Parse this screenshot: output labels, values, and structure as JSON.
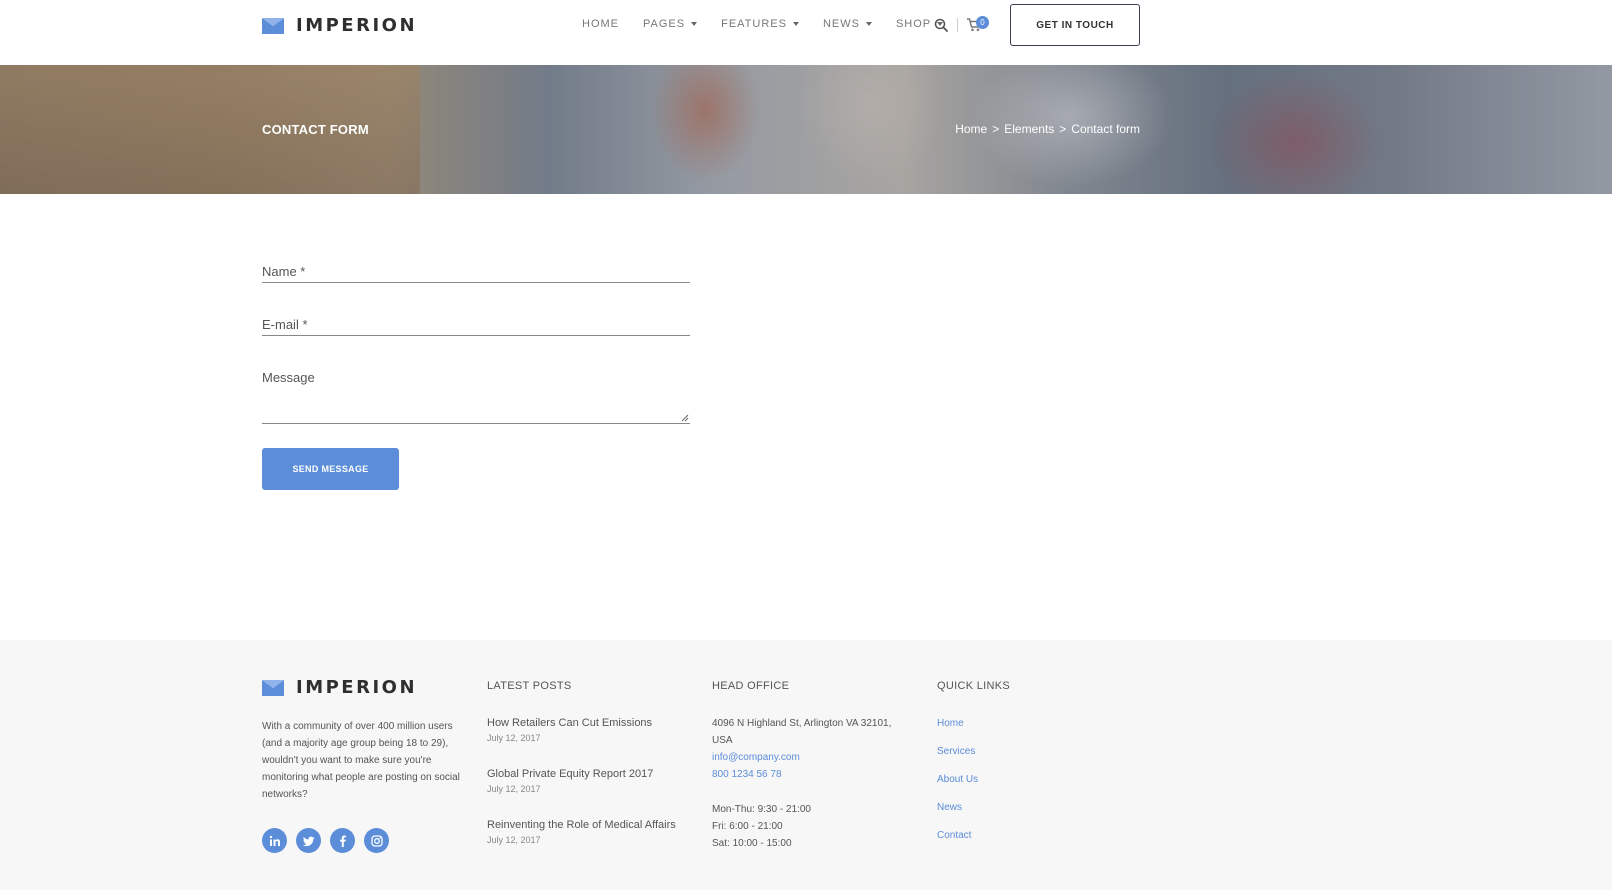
{
  "brand": {
    "name": "IMPERION",
    "accent": "#5b8dd9"
  },
  "header": {
    "nav": [
      {
        "label": "HOME",
        "dropdown": false
      },
      {
        "label": "PAGES",
        "dropdown": true
      },
      {
        "label": "FEATURES",
        "dropdown": true
      },
      {
        "label": "NEWS",
        "dropdown": true
      },
      {
        "label": "SHOP",
        "dropdown": true
      }
    ],
    "cart_count": "0",
    "cta_label": "GET IN TOUCH",
    "icons": [
      "search-icon",
      "cart-icon"
    ]
  },
  "hero": {
    "title": "CONTACT FORM",
    "breadcrumbs": [
      "Home",
      ">",
      "Elements",
      ">",
      "Contact form"
    ]
  },
  "form": {
    "name_label": "Name *",
    "email_label": "E-mail *",
    "message_label": "Message",
    "submit_label": "SEND MESSAGE"
  },
  "footer": {
    "about": "With a community of over 400 million users (and a majority age group being 18 to 29), wouldn't you want to make sure you're monitoring what people are posting on social networks?",
    "socials": [
      "linkedin-icon",
      "twitter-icon",
      "facebook-icon",
      "instagram-icon"
    ],
    "latest_posts": {
      "heading": "LATEST POSTS",
      "items": [
        {
          "title": "How Retailers Can Cut Emissions",
          "date": "July 12, 2017"
        },
        {
          "title": "Global Private Equity Report 2017",
          "date": "July 12, 2017"
        },
        {
          "title": "Reinventing the Role of Medical Affairs",
          "date": "July 12, 2017"
        }
      ]
    },
    "head_office": {
      "heading": "HEAD OFFICE",
      "address": "4096 N Highland St, Arlington VA 32101, USA",
      "email": "info@company.com",
      "phone": "800 1234 56 78",
      "hours": [
        "Mon-Thu: 9:30 - 21:00",
        "Fri: 6:00 - 21:00",
        "Sat: 10:00 - 15:00"
      ]
    },
    "quick_links": {
      "heading": "QUICK LINKS",
      "items": [
        "Home",
        "Services",
        "About Us",
        "News",
        "Contact"
      ]
    }
  }
}
